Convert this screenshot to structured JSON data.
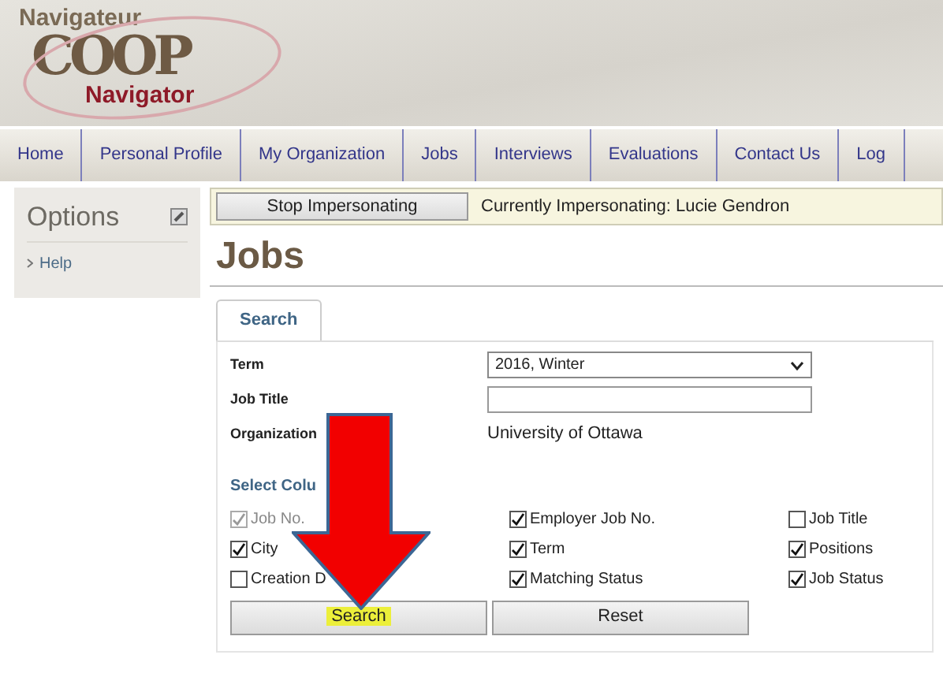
{
  "logo": {
    "top": "Navigateur",
    "main": "COOP",
    "bottom": "Navigator"
  },
  "nav": [
    {
      "label": "Home"
    },
    {
      "label": "Personal Profile"
    },
    {
      "label": "My Organization"
    },
    {
      "label": "Jobs"
    },
    {
      "label": "Interviews"
    },
    {
      "label": "Evaluations"
    },
    {
      "label": "Contact Us"
    },
    {
      "label": "Log"
    }
  ],
  "sidebar": {
    "title": "Options",
    "items": [
      {
        "label": "Help"
      }
    ]
  },
  "impersonation": {
    "button": "Stop Impersonating",
    "message": "Currently Impersonating: Lucie Gendron"
  },
  "page_title": "Jobs",
  "tabs": [
    {
      "label": "Search",
      "selected": true
    }
  ],
  "form": {
    "term": {
      "label": "Term",
      "value": "2016, Winter"
    },
    "job_title": {
      "label": "Job Title"
    },
    "organization": {
      "label": "Organization",
      "value": "University of Ottawa"
    }
  },
  "columns_heading": "Select Colu",
  "columns": [
    {
      "label": "Job No.",
      "checked": true,
      "disabled": true
    },
    {
      "label": "Employer Job No.",
      "checked": true,
      "disabled": false
    },
    {
      "label": "Job Title",
      "checked": false,
      "disabled": false
    },
    {
      "label": "City",
      "checked": true,
      "disabled": false
    },
    {
      "label": "Term",
      "checked": true,
      "disabled": false
    },
    {
      "label": "Positions",
      "checked": true,
      "disabled": false
    },
    {
      "label": "Creation D",
      "checked": false,
      "disabled": false
    },
    {
      "label": "Matching Status",
      "checked": true,
      "disabled": false
    },
    {
      "label": "Job Status",
      "checked": true,
      "disabled": false
    }
  ],
  "buttons": [
    {
      "label": "Search",
      "highlighted": true
    },
    {
      "label": "Reset",
      "highlighted": false
    }
  ]
}
